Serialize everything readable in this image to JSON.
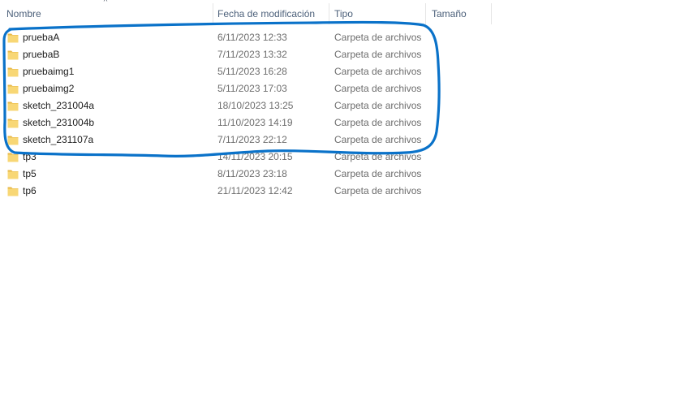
{
  "columns": {
    "name": "Nombre",
    "modified": "Fecha de modificación",
    "type": "Tipo",
    "size": "Tamaño"
  },
  "sort_indicator": "^",
  "files": [
    {
      "name": "pruebaA",
      "modified": "6/11/2023 12:33",
      "type": "Carpeta de archivos",
      "size": ""
    },
    {
      "name": "pruebaB",
      "modified": "7/11/2023 13:32",
      "type": "Carpeta de archivos",
      "size": ""
    },
    {
      "name": "pruebaimg1",
      "modified": "5/11/2023 16:28",
      "type": "Carpeta de archivos",
      "size": ""
    },
    {
      "name": "pruebaimg2",
      "modified": "5/11/2023 17:03",
      "type": "Carpeta de archivos",
      "size": ""
    },
    {
      "name": "sketch_231004a",
      "modified": "18/10/2023 13:25",
      "type": "Carpeta de archivos",
      "size": ""
    },
    {
      "name": "sketch_231004b",
      "modified": "11/10/2023 14:19",
      "type": "Carpeta de archivos",
      "size": ""
    },
    {
      "name": "sketch_231107a",
      "modified": "7/11/2023 22:12",
      "type": "Carpeta de archivos",
      "size": ""
    },
    {
      "name": "tp3",
      "modified": "14/11/2023 20:15",
      "type": "Carpeta de archivos",
      "size": ""
    },
    {
      "name": "tp5",
      "modified": "8/11/2023 23:18",
      "type": "Carpeta de archivos",
      "size": ""
    },
    {
      "name": "tp6",
      "modified": "21/11/2023 12:42",
      "type": "Carpeta de archivos",
      "size": ""
    }
  ],
  "icons": {
    "folder": "folder-icon",
    "sort": "sort-ascending-icon"
  },
  "colors": {
    "folder_fill": "#f8d775",
    "folder_tab": "#e8b949",
    "annotation_stroke": "#0a72c9",
    "header_text": "#4c607a",
    "secondary_text": "#6d6d6d"
  }
}
